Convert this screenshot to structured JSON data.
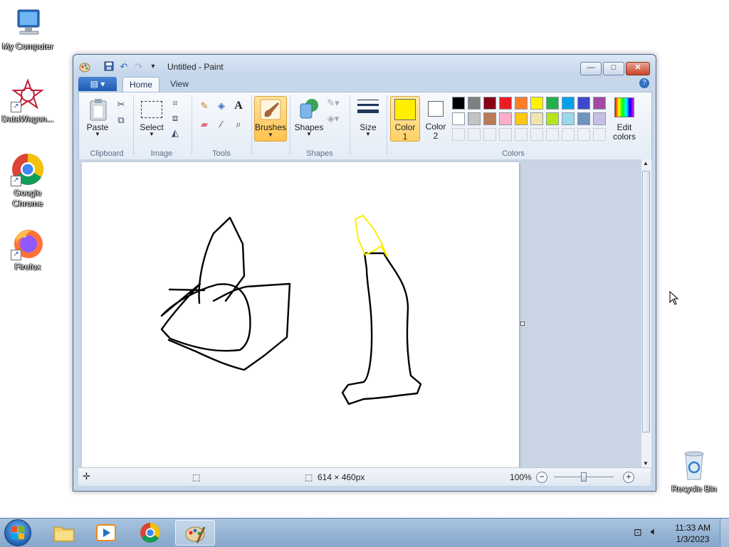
{
  "desktop": {
    "icons": [
      {
        "label": "My Computer"
      },
      {
        "label": "DataWagon..."
      },
      {
        "label": "Google Chrome"
      },
      {
        "label": "Firefox"
      },
      {
        "label": "Recycle Bin"
      }
    ]
  },
  "window": {
    "title": "Untitled - Paint",
    "controls": {
      "minimize": "—",
      "maximize": "□",
      "close": "✕"
    }
  },
  "ribbon": {
    "tabs": {
      "home": "Home",
      "view": "View"
    },
    "clipboard": {
      "paste": "Paste",
      "group": "Clipboard"
    },
    "image": {
      "select": "Select",
      "group": "Image"
    },
    "tools": {
      "group": "Tools"
    },
    "brushes": {
      "label": "Brushes"
    },
    "shapes": {
      "label": "Shapes",
      "group": "Shapes"
    },
    "size": {
      "label": "Size"
    },
    "colors": {
      "color1_line1": "Color",
      "color1_line2": "1",
      "color2_line1": "Color",
      "color2_line2": "2",
      "edit_line1": "Edit",
      "edit_line2": "colors",
      "group": "Colors",
      "color1_value": "#ffee00",
      "color2_value": "#ffffff",
      "palette_row1": [
        "#000000",
        "#7f7f7f",
        "#880015",
        "#ed1c24",
        "#ff7f27",
        "#fff200",
        "#22b14c",
        "#00a2e8",
        "#3f48cc",
        "#a349a4"
      ],
      "palette_row2": [
        "#ffffff",
        "#c3c3c3",
        "#b97a57",
        "#ffaec9",
        "#ffc90e",
        "#efe4b0",
        "#b5e61d",
        "#99d9ea",
        "#7092be",
        "#c8bfe7"
      ]
    }
  },
  "status": {
    "dimensions": "614 × 460px",
    "zoom": "100%"
  },
  "taskbar": {
    "time": "11:33 AM",
    "date": "1/3/2023"
  }
}
